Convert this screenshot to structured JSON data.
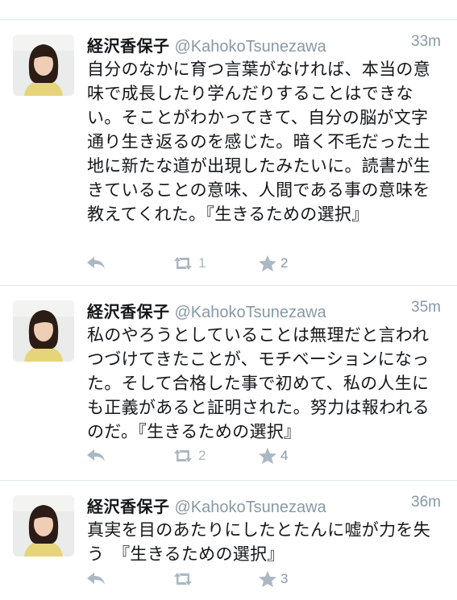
{
  "colors": {
    "icon": "#aab8c2",
    "separator": "#e1e8ed",
    "muted": "#8899a6"
  },
  "tweets": [
    {
      "name": "経沢香保子",
      "handle": "@KahokoTsunezawa",
      "time": "33m",
      "text": "自分のなかに育つ言葉がなければ、本当の意味で成長したり学んだりすることはできない。そことがわかってきて、自分の脳が文字通り生き返るのを感じた。暗く不毛だった土地に新たな道が出現したみたいに。読書が生きていることの意味、人間である事の意味を教えてくれた。『生きるための選択』",
      "retweets": "1",
      "favorites": "2"
    },
    {
      "name": "経沢香保子",
      "handle": "@KahokoTsunezawa",
      "time": "35m",
      "text": "私のやろうとしていることは無理だと言われつづけてきたことが、モチベーションになった。そして合格した事で初めて、私の人生にも正義があると証明された。努力は報われるのだ。『生きるための選択』",
      "retweets": "2",
      "favorites": "4"
    },
    {
      "name": "経沢香保子",
      "handle": "@KahokoTsunezawa",
      "time": "36m",
      "text": "真実を目のあたりにしたとたんに嘘が力を失う　『生きるための選択』",
      "retweets": "",
      "favorites": "3"
    }
  ]
}
